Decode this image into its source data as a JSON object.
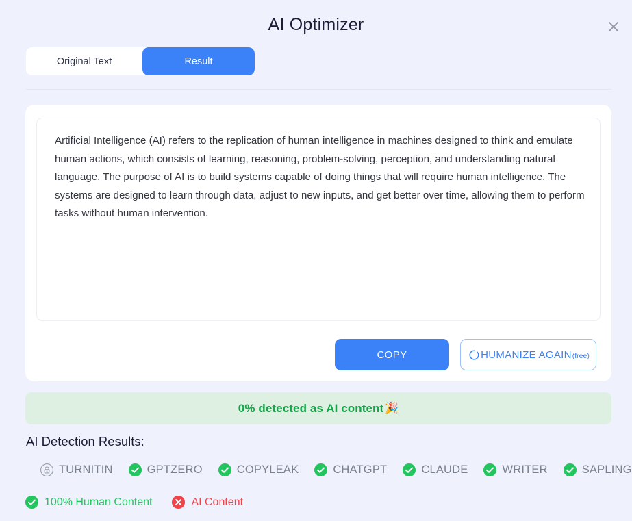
{
  "modal": {
    "title": "AI Optimizer",
    "close_icon": "close-icon"
  },
  "tabs": [
    {
      "label": "Original Text",
      "active": false
    },
    {
      "label": "Result",
      "active": true
    }
  ],
  "result": {
    "text": "Artificial Intelligence (AI) refers to the replication of human intelligence in machines designed to think and emulate human actions, which consists of learning, reasoning, problem-solving, perception, and understanding natural language. The purpose of AI is to build systems capable of doing things that will require human intelligence. The systems are designed to learn through data, adjust to new inputs, and get better over time, allowing them to perform tasks without human intervention."
  },
  "actions": {
    "copy_label": "COPY",
    "humanize_label": "HUMANIZE AGAIN",
    "humanize_suffix": "(free)",
    "humanize_icon": "refresh-spinner-icon"
  },
  "banner": {
    "text": "0% detected as AI content",
    "emoji": "🎉",
    "background": "#ddf0e2",
    "color": "#16a34a"
  },
  "detection": {
    "heading": "AI Detection Results:",
    "detectors": [
      {
        "name": "TURNITIN",
        "status": "locked",
        "icon": "lock-icon"
      },
      {
        "name": "GPTZERO",
        "status": "passed",
        "icon": "check-circle-icon"
      },
      {
        "name": "COPYLEAK",
        "status": "passed",
        "icon": "check-circle-icon"
      },
      {
        "name": "CHATGPT",
        "status": "passed",
        "icon": "check-circle-icon"
      },
      {
        "name": "CLAUDE",
        "status": "passed",
        "icon": "check-circle-icon"
      },
      {
        "name": "WRITER",
        "status": "passed",
        "icon": "check-circle-icon"
      },
      {
        "name": "SAPLING",
        "status": "passed",
        "icon": "check-circle-icon"
      }
    ]
  },
  "legend": [
    {
      "label": "100% Human Content",
      "icon": "check-circle-icon",
      "color": "#22c55e"
    },
    {
      "label": "AI Content",
      "icon": "x-circle-icon",
      "color": "#f0434a"
    }
  ],
  "colors": {
    "background": "#eff2fc",
    "accent": "#3b82f8",
    "success": "#22c55e",
    "danger": "#f0434a",
    "muted": "#7b808f"
  }
}
